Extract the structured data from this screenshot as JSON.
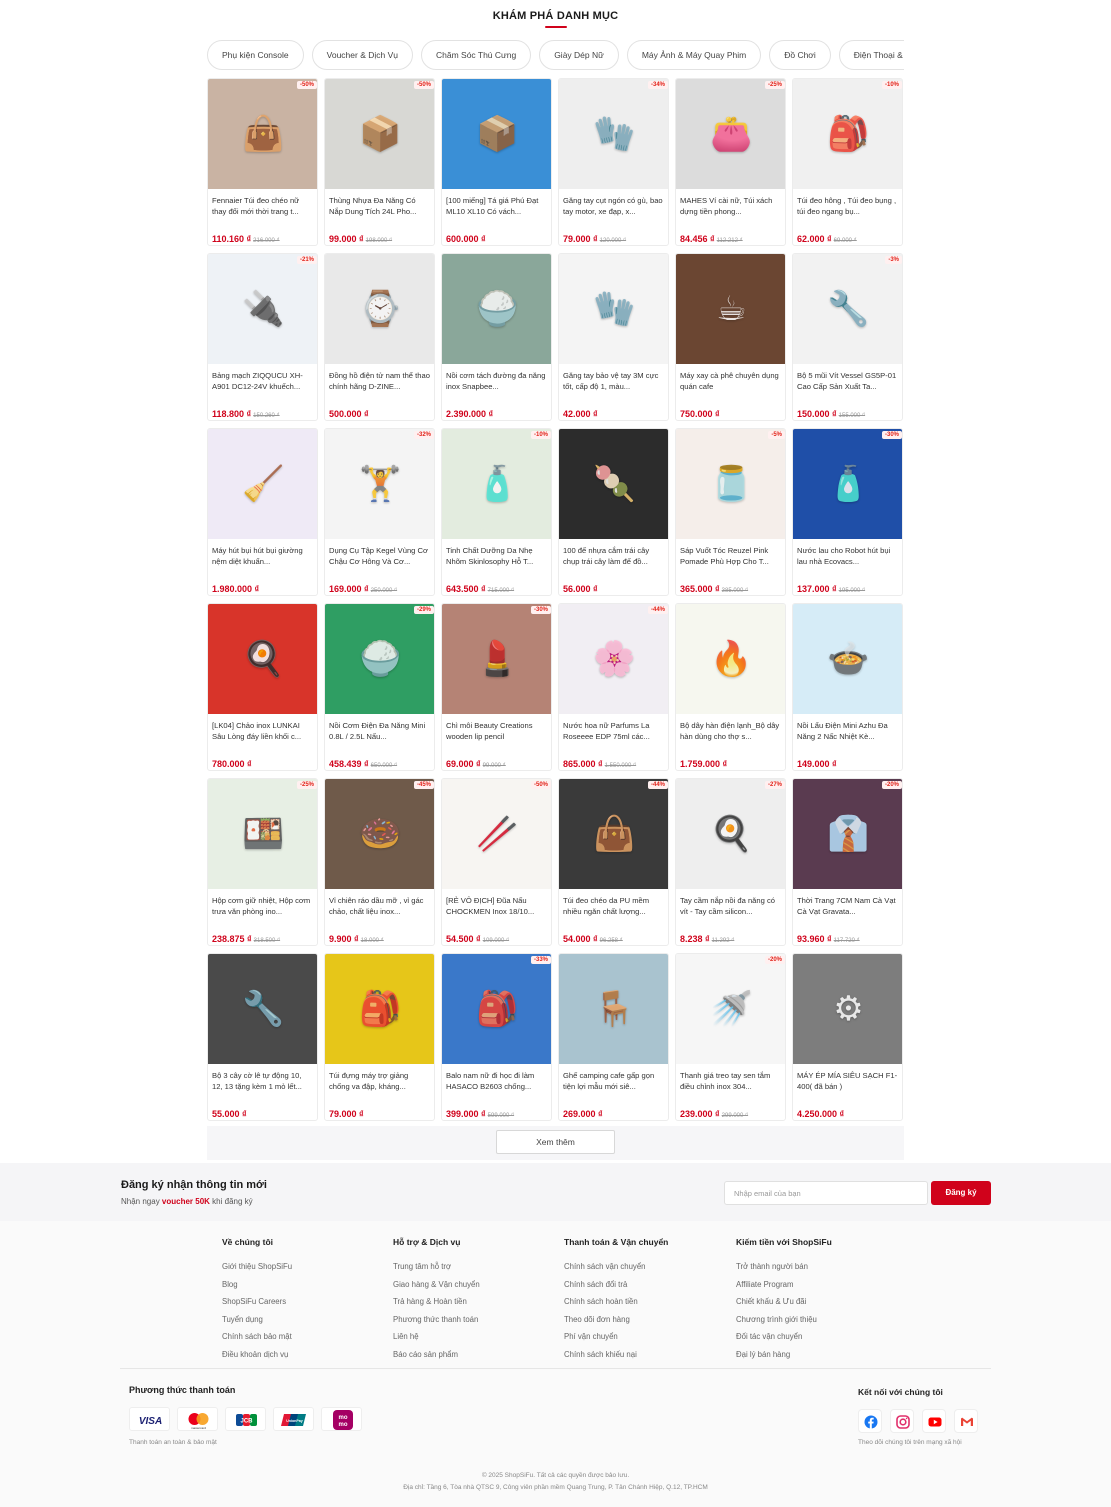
{
  "section_title": "KHÁM PHÁ DANH MỤC",
  "categories": [
    "Phụ kiện Console",
    "Voucher & Dịch Vụ",
    "Chăm Sóc Thú Cưng",
    "Giày Dép Nữ",
    "Máy Ảnh & Máy Quay Phim",
    "Đồ Chơi",
    "Điện Thoại & Phụ Kiện"
  ],
  "products": [
    {
      "name": "Fennaier Túi đeo chéo nữ thay đổi mới thời trang t...",
      "price": "110.160 ₫",
      "old": "216.000 ₫",
      "discount": "-50%",
      "color": "#c9b3a3",
      "glyph": "👜"
    },
    {
      "name": "Thùng Nhựa Đa Năng Có Nắp Dung Tích 24L Pho...",
      "price": "99.000 ₫",
      "old": "198.000 ₫",
      "discount": "-50%",
      "color": "#d8d8d4",
      "glyph": "📦"
    },
    {
      "name": "[100 miếng] Tá giá Phú Đạt ML10 XL10 Có vách...",
      "price": "600.000 ₫",
      "old": "",
      "discount": "",
      "color": "#3a8fd6",
      "glyph": "📦"
    },
    {
      "name": "Găng tay cụt ngón có gù, bao tay motor, xe đạp, x...",
      "price": "79.000 ₫",
      "old": "120.000 ₫",
      "discount": "-34%",
      "color": "#eeeeee",
      "glyph": "🧤"
    },
    {
      "name": "MAHES Ví cài nữ, Túi xách dựng tiền phong...",
      "price": "84.456 ₫",
      "old": "112.212 ₫",
      "discount": "-25%",
      "color": "#dcdcdc",
      "glyph": "👛"
    },
    {
      "name": "Túi đeo hông , Túi đeo bụng , túi đeo ngang bụ...",
      "price": "62.000 ₫",
      "old": "69.000 ₫",
      "discount": "-10%",
      "color": "#f0f0f0",
      "glyph": "🎒"
    },
    {
      "name": "Bảng mạch ZIQQUCU XH-A901 DC12-24V khuếch...",
      "price": "118.800 ₫",
      "old": "150.260 ₫",
      "discount": "-21%",
      "color": "#eef2f6",
      "glyph": "🔌"
    },
    {
      "name": "Đồng hồ điện tử nam thể thao chính hãng D-ZINE...",
      "price": "500.000 ₫",
      "old": "",
      "discount": "",
      "color": "#e9e9e9",
      "glyph": "⌚"
    },
    {
      "name": "Nồi cơm tách đường đa năng inox Snapbee...",
      "price": "2.390.000 ₫",
      "old": "",
      "discount": "",
      "color": "#8aa79a",
      "glyph": "🍚"
    },
    {
      "name": "Găng tay bảo vệ tay 3M cực tốt, cấp độ 1, màu...",
      "price": "42.000 ₫",
      "old": "",
      "discount": "",
      "color": "#f4f4f4",
      "glyph": "🧤"
    },
    {
      "name": "Máy xay cà phê chuyên dụng quán cafe",
      "price": "750.000 ₫",
      "old": "",
      "discount": "",
      "color": "#6b4632",
      "glyph": "☕"
    },
    {
      "name": "Bộ 5 mũi Vít Vessel GS5P-01 Cao Cấp Sản Xuất Ta...",
      "price": "150.000 ₫",
      "old": "155.000 ₫",
      "discount": "-3%",
      "color": "#f2f2f2",
      "glyph": "🔧"
    },
    {
      "name": "Máy hút bụi hút bụi giường nệm diệt khuẩn...",
      "price": "1.980.000 ₫",
      "old": "",
      "discount": "",
      "color": "#efeaf6",
      "glyph": "🧹"
    },
    {
      "name": "Dụng Cụ Tập Kegel Vùng Cơ Chậu Cơ Hông Và Cơ...",
      "price": "169.000 ₫",
      "old": "250.000 ₫",
      "discount": "-32%",
      "color": "#f4f4f4",
      "glyph": "🏋"
    },
    {
      "name": "Tinh Chất Dưỡng Da Nhẹ Nhõm Skinlosophy Hỗ T...",
      "price": "643.500 ₫",
      "old": "715.000 ₫",
      "discount": "-10%",
      "color": "#e3ecdf",
      "glyph": "🧴"
    },
    {
      "name": "100 đế nhựa cắm trái cây chụp trái cây làm đế đồ...",
      "price": "56.000 ₫",
      "old": "",
      "discount": "",
      "color": "#2c2c2c",
      "glyph": "🍡"
    },
    {
      "name": "Sáp Vuốt Tóc Reuzel Pink Pomade Phù Hợp Cho T...",
      "price": "365.000 ₫",
      "old": "385.000 ₫",
      "discount": "-5%",
      "color": "#f5eeea",
      "glyph": "🫙"
    },
    {
      "name": "Nước lau cho Robot hút bụi lau nhà Ecovacs...",
      "price": "137.000 ₫",
      "old": "195.000 ₫",
      "discount": "-30%",
      "color": "#1f4fa8",
      "glyph": "🧴"
    },
    {
      "name": "[LK04] Chảo inox LUNKAI Sâu Lòng đáy liền khối c...",
      "price": "780.000 ₫",
      "old": "",
      "discount": "",
      "color": "#d8342a",
      "glyph": "🍳"
    },
    {
      "name": "Nồi Cơm Điện Đa Năng Mini 0.8L / 2.5L Nấu...",
      "price": "458.439 ₫",
      "old": "650.000 ₫",
      "discount": "-29%",
      "color": "#2f9e63",
      "glyph": "🍚"
    },
    {
      "name": "Chì môi Beauty Creations wooden lip pencil",
      "price": "69.000 ₫",
      "old": "99.000 ₫",
      "discount": "-30%",
      "color": "#b58375",
      "glyph": "💄"
    },
    {
      "name": "Nước hoa nữ Parfums La Roseeee EDP 75ml các...",
      "price": "865.000 ₫",
      "old": "1.550.000 ₫",
      "discount": "-44%",
      "color": "#f1eef3",
      "glyph": "🌸"
    },
    {
      "name": "Bộ dây hàn điện lạnh_Bộ dây hàn dùng cho thợ s...",
      "price": "1.759.000 ₫",
      "old": "",
      "discount": "",
      "color": "#f6f7ef",
      "glyph": "🔥"
    },
    {
      "name": "Nồi Lẩu Điện Mini Azhu Đa Năng 2 Nấc Nhiệt Kè...",
      "price": "149.000 ₫",
      "old": "",
      "discount": "",
      "color": "#d6ecf7",
      "glyph": "🍲"
    },
    {
      "name": "Hộp cơm giữ nhiệt, Hộp cơm trưa văn phòng ino...",
      "price": "238.875 ₫",
      "old": "318.500 ₫",
      "discount": "-25%",
      "color": "#e7efe4",
      "glyph": "🍱"
    },
    {
      "name": "Vỉ chiên ráo dầu mỡ , vỉ gác chảo, chất liệu inox...",
      "price": "9.900 ₫",
      "old": "18.000 ₫",
      "discount": "-45%",
      "color": "#6f5a4a",
      "glyph": "🍩"
    },
    {
      "name": "[RẺ VÔ ĐỊCH] Đũa Nấu CHOCKMEN Inox 18/10...",
      "price": "54.500 ₫",
      "old": "109.000 ₫",
      "discount": "-50%",
      "color": "#f7f5f2",
      "glyph": "🥢"
    },
    {
      "name": "Túi đeo chéo da PU mềm nhiều ngăn chất lượng...",
      "price": "54.000 ₫",
      "old": "96.258 ₫",
      "discount": "-44%",
      "color": "#3a3a3a",
      "glyph": "👜"
    },
    {
      "name": "Tay cầm nắp nồi đa năng có vít - Tay cầm silicon...",
      "price": "8.238 ₫",
      "old": "11.292 ₫",
      "discount": "-27%",
      "color": "#eeeeee",
      "glyph": "🍳"
    },
    {
      "name": "Thời Trang 7CM Nam Cà Vạt Cà Vạt Gravata...",
      "price": "93.960 ₫",
      "old": "117.720 ₫",
      "discount": "-20%",
      "color": "#5a3b50",
      "glyph": "👔"
    },
    {
      "name": "Bộ 3 cây cờ lê tự động 10, 12, 13 tặng kèm 1 mỏ lết...",
      "price": "55.000 ₫",
      "old": "",
      "discount": "",
      "color": "#4a4a4a",
      "glyph": "🔧"
    },
    {
      "name": "Túi đựng máy trợ giảng chống va đập, kháng...",
      "price": "79.000 ₫",
      "old": "",
      "discount": "",
      "color": "#e6c619",
      "glyph": "🎒"
    },
    {
      "name": "Balo nam nữ đi học đi làm HASACO B2603 chống...",
      "price": "399.000 ₫",
      "old": "599.000 ₫",
      "discount": "-33%",
      "color": "#3a78c9",
      "glyph": "🎒"
    },
    {
      "name": "Ghế camping cafe gấp gọn tiện lợi mẫu mới siê...",
      "price": "269.000 ₫",
      "old": "",
      "discount": "",
      "color": "#a9c3cf",
      "glyph": "🪑"
    },
    {
      "name": "Thanh giá treo tay sen tắm điều chỉnh inox 304...",
      "price": "239.000 ₫",
      "old": "299.000 ₫",
      "discount": "-20%",
      "color": "#f6f6f6",
      "glyph": "🚿"
    },
    {
      "name": "MÁY ÉP MÍA SIÊU SẠCH F1-400( đã bán )",
      "price": "4.250.000 ₫",
      "old": "",
      "discount": "",
      "color": "#7d7d7d",
      "glyph": "⚙"
    }
  ],
  "more_button": "Xem thêm",
  "newsletter": {
    "title": "Đăng ký nhận thông tin mới",
    "sub_prefix": "Nhận ngay ",
    "sub_highlight": "voucher 50K",
    "sub_suffix": " khi đăng ký",
    "placeholder": "Nhập email của bạn",
    "button": "Đăng ký"
  },
  "footer_columns": [
    {
      "title": "Về chúng tôi",
      "links": [
        "Giới thiệu ShopSiFu",
        "Blog",
        "ShopSiFu Careers",
        "Tuyển dụng",
        "Chính sách bảo mật",
        "Điều khoản dịch vụ"
      ]
    },
    {
      "title": "Hỗ trợ & Dịch vụ",
      "links": [
        "Trung tâm hỗ trợ",
        "Giao hàng & Vận chuyển",
        "Trả hàng & Hoàn tiền",
        "Phương thức thanh toán",
        "Liên hệ",
        "Báo cáo sản phẩm"
      ]
    },
    {
      "title": "Thanh toán & Vận chuyển",
      "links": [
        "Chính sách vận chuyển",
        "Chính sách đổi trả",
        "Chính sách hoàn tiền",
        "Theo dõi đơn hàng",
        "Phí vận chuyển",
        "Chính sách khiếu nại"
      ]
    },
    {
      "title": "Kiếm tiền với ShopSiFu",
      "links": [
        "Trở thành người bán",
        "Affiliate Program",
        "Chiết khấu & Ưu đãi",
        "Chương trình giới thiệu",
        "Đối tác vận chuyển",
        "Đại lý bán hàng"
      ]
    }
  ],
  "payments": {
    "title": "Phương thức thanh toán",
    "methods": [
      "VISA",
      "mastercard",
      "JCB",
      "UnionPay",
      "momo"
    ],
    "note": "Thanh toán an toàn & bảo mật"
  },
  "social": {
    "title": "Kết nối với chúng tôi",
    "icons": [
      "facebook-icon",
      "instagram-icon",
      "youtube-icon",
      "gmail-icon"
    ],
    "note": "Theo dõi chúng tôi trên mạng xã hội"
  },
  "copyright": "© 2025 ShopSiFu. Tất cả các quyền được bảo lưu.",
  "address": "Địa chỉ: Tầng 6, Tòa nhà QTSC 9, Công viên phần mềm Quang Trung, P. Tân Chánh Hiệp, Q.12, TP.HCM",
  "colors": {
    "accent": "#d0021b",
    "price": "#d0021b"
  }
}
